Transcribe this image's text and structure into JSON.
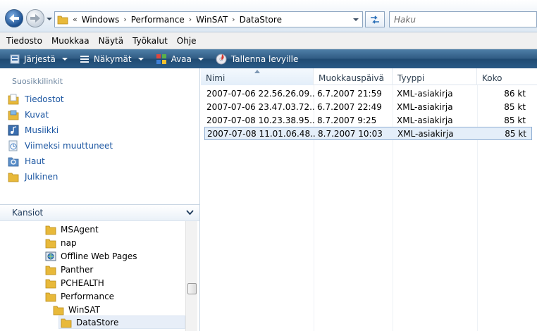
{
  "nav": {
    "breadcrumb_prefix": "«",
    "breadcrumbs": [
      "Windows",
      "Performance",
      "WinSAT",
      "DataStore"
    ],
    "search_placeholder": "Haku"
  },
  "menu": [
    "Tiedosto",
    "Muokkaa",
    "Näytä",
    "Työkalut",
    "Ohje"
  ],
  "commands": [
    {
      "label": "Järjestä",
      "icon": "organize-icon"
    },
    {
      "label": "Näkymät",
      "icon": "views-icon"
    },
    {
      "label": "Avaa",
      "icon": "open-icon"
    },
    {
      "label": "Tallenna levyille",
      "icon": "burn-icon"
    }
  ],
  "favorites": {
    "title": "Suosikkilinkit",
    "items": [
      {
        "label": "Tiedostot",
        "icon": "documents-icon"
      },
      {
        "label": "Kuvat",
        "icon": "pictures-icon"
      },
      {
        "label": "Musiikki",
        "icon": "music-icon"
      },
      {
        "label": "Viimeksi muuttuneet",
        "icon": "recent-icon"
      },
      {
        "label": "Haut",
        "icon": "searches-icon"
      },
      {
        "label": "Julkinen",
        "icon": "public-icon"
      }
    ]
  },
  "folders": {
    "title": "Kansiot",
    "items": [
      {
        "label": "MSAgent",
        "icon": "folder-icon",
        "level": 0
      },
      {
        "label": "nap",
        "icon": "folder-icon",
        "level": 0
      },
      {
        "label": "Offline Web Pages",
        "icon": "offline-pages-icon",
        "level": 0
      },
      {
        "label": "Panther",
        "icon": "folder-icon",
        "level": 0
      },
      {
        "label": "PCHEALTH",
        "icon": "folder-icon",
        "level": 0
      },
      {
        "label": "Performance",
        "icon": "folder-icon",
        "level": 0
      },
      {
        "label": "WinSAT",
        "icon": "folder-icon",
        "level": 1
      },
      {
        "label": "DataStore",
        "icon": "folder-icon",
        "level": 2,
        "selected": true
      }
    ]
  },
  "columns": [
    "Nimi",
    "Muokkauspäivä",
    "Tyyppi",
    "Koko"
  ],
  "files": [
    {
      "name": "2007-07-06 22.56.26.09...",
      "modified": "6.7.2007 21:59",
      "type": "XML-asiakirja",
      "size": "86 kt"
    },
    {
      "name": "2007-07-06 23.47.03.72...",
      "modified": "6.7.2007 22:49",
      "type": "XML-asiakirja",
      "size": "85 kt"
    },
    {
      "name": "2007-07-08 10.23.38.95...",
      "modified": "8.7.2007 9:25",
      "type": "XML-asiakirja",
      "size": "85 kt"
    },
    {
      "name": "2007-07-08 11.01.06.48...",
      "modified": "8.7.2007 10:03",
      "type": "XML-asiakirja",
      "size": "85 kt",
      "selected": true
    }
  ],
  "colors": {
    "command_bar": "#2f5a82",
    "link_blue": "#1d57a2",
    "selection": "#e4eef9"
  }
}
